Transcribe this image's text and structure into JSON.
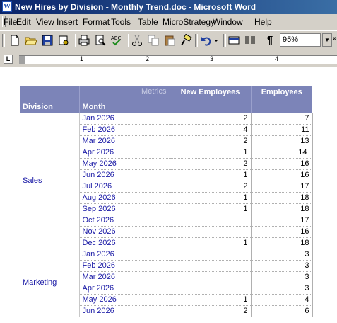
{
  "window": {
    "title": "New Hires by Division - Monthly Trend.doc - Microsoft Word",
    "app_icon": "W"
  },
  "menu": [
    {
      "pre": "",
      "u": "F",
      "post": "ile"
    },
    {
      "pre": "",
      "u": "E",
      "post": "dit"
    },
    {
      "pre": "",
      "u": "V",
      "post": "iew"
    },
    {
      "pre": "",
      "u": "I",
      "post": "nsert"
    },
    {
      "pre": "F",
      "u": "o",
      "post": "rmat"
    },
    {
      "pre": "",
      "u": "T",
      "post": "ools"
    },
    {
      "pre": "T",
      "u": "a",
      "post": "ble"
    },
    {
      "pre": "",
      "u": "M",
      "post": "icroStrategy"
    },
    {
      "pre": "",
      "u": "W",
      "post": "indow"
    },
    {
      "pre": "",
      "u": "H",
      "post": "elp"
    }
  ],
  "toolbar": {
    "zoom": "95%",
    "pilcrow": "¶",
    "more": "»"
  },
  "ruler": {
    "tab_selector": "L",
    "marks": [
      "1",
      "2",
      "3",
      "4"
    ]
  },
  "report": {
    "headers": {
      "division": "Division",
      "month": "Month",
      "metrics": "Metrics",
      "new_employees": "New Employees",
      "employees": "Employees"
    },
    "groups": [
      {
        "division": "Sales",
        "rows": [
          {
            "month": "Jan 2026",
            "new": "2",
            "emp": "7"
          },
          {
            "month": "Feb 2026",
            "new": "4",
            "emp": "11"
          },
          {
            "month": "Mar 2026",
            "new": "2",
            "emp": "13"
          },
          {
            "month": "Apr 2026",
            "new": "1",
            "emp": "14"
          },
          {
            "month": "May 2026",
            "new": "2",
            "emp": "16"
          },
          {
            "month": "Jun 2026",
            "new": "1",
            "emp": "16"
          },
          {
            "month": "Jul 2026",
            "new": "2",
            "emp": "17"
          },
          {
            "month": "Aug 2026",
            "new": "1",
            "emp": "18"
          },
          {
            "month": "Sep 2026",
            "new": "1",
            "emp": "18"
          },
          {
            "month": "Oct 2026",
            "new": "",
            "emp": "17"
          },
          {
            "month": "Nov 2026",
            "new": "",
            "emp": "16"
          },
          {
            "month": "Dec 2026",
            "new": "1",
            "emp": "18"
          }
        ]
      },
      {
        "division": "Marketing",
        "rows": [
          {
            "month": "Jan 2026",
            "new": "",
            "emp": "3"
          },
          {
            "month": "Feb 2026",
            "new": "",
            "emp": "3"
          },
          {
            "month": "Mar 2026",
            "new": "",
            "emp": "3"
          },
          {
            "month": "Apr 2026",
            "new": "",
            "emp": "3"
          },
          {
            "month": "May 2026",
            "new": "1",
            "emp": "4"
          },
          {
            "month": "Jun 2026",
            "new": "2",
            "emp": "6"
          }
        ]
      }
    ]
  },
  "colors": {
    "title_start": "#0a246a",
    "title_end": "#3a6ea5",
    "header_bg": "#7c84b8",
    "link_text": "#1a1aa6"
  }
}
